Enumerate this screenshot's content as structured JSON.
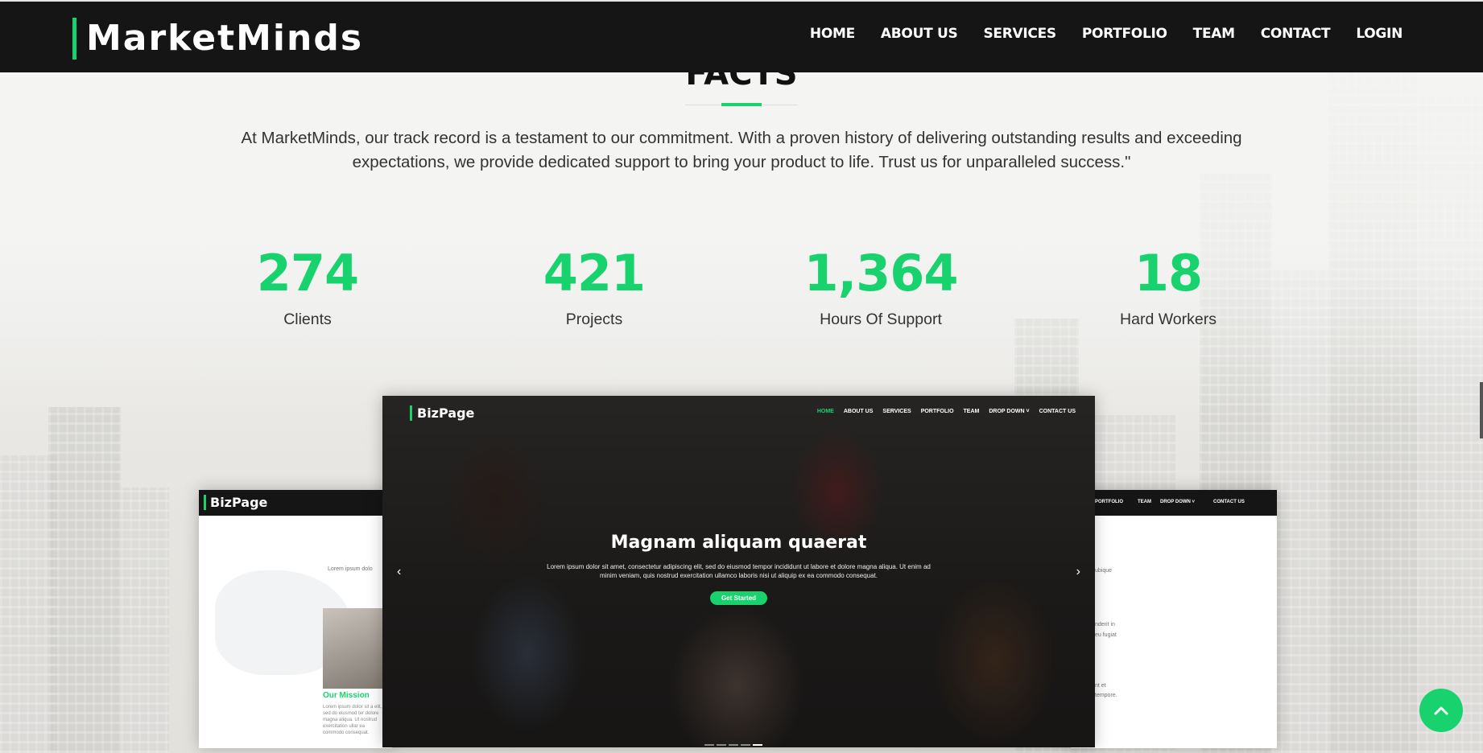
{
  "header": {
    "logo": "MarketMinds",
    "nav": [
      "HOME",
      "ABOUT US",
      "SERVICES",
      "PORTFOLIO",
      "TEAM",
      "CONTACT",
      "LOGIN"
    ]
  },
  "facts": {
    "title": "FACTS",
    "description": "At MarketMinds, our track record is a testament to our commitment. With a proven history of delivering outstanding results and exceeding expectations, we provide dedicated support to bring your product to life. Trust us for unparalleled success.\"",
    "counters": [
      {
        "value": "274",
        "label": "Clients"
      },
      {
        "value": "421",
        "label": "Projects"
      },
      {
        "value": "1,364",
        "label": "Hours Of Support"
      },
      {
        "value": "18",
        "label": "Hard Workers"
      }
    ]
  },
  "mockups": {
    "main": {
      "brand": "BizPage",
      "nav": [
        "HOME",
        "ABOUT US",
        "SERVICES",
        "PORTFOLIO",
        "TEAM",
        "DROP DOWN ˅",
        "CONTACT US"
      ],
      "hero_title": "Magnam aliquam quaerat",
      "hero_text": "Lorem ipsum dolor sit amet, consectetur adipiscing elit, sed do eiusmod tempor incididunt ut labore et dolore magna aliqua. Ut enim ad minim veniam, quis nostrud exercitation ullamco laboris nisi ut aliquip ex ea commodo consequat.",
      "hero_button": "Get Started",
      "prev": "‹",
      "next": "›"
    },
    "left": {
      "brand": "BizPage",
      "lorem": "Lorem ipsum dolo",
      "mission": "Our Mission",
      "mission_text": "Lorem ipsum dolor sit a elit, sed do eiusmod ter dolore magna aliqua. Ut nostrud exercitation ullar ea commodo consequat."
    },
    "right": {
      "nav": [
        "PORTFOLIO",
        "TEAM",
        "DROP DOWN ˅",
        "CONTACT US"
      ],
      "snippets": [
        "ubique",
        "nderit in",
        "eu fugiat",
        "nt et",
        "tempore."
      ]
    }
  },
  "colors": {
    "accent": "#18d26e",
    "header_bg": "#151515"
  },
  "icons": {
    "back_to_top": "chevron-up-icon"
  }
}
